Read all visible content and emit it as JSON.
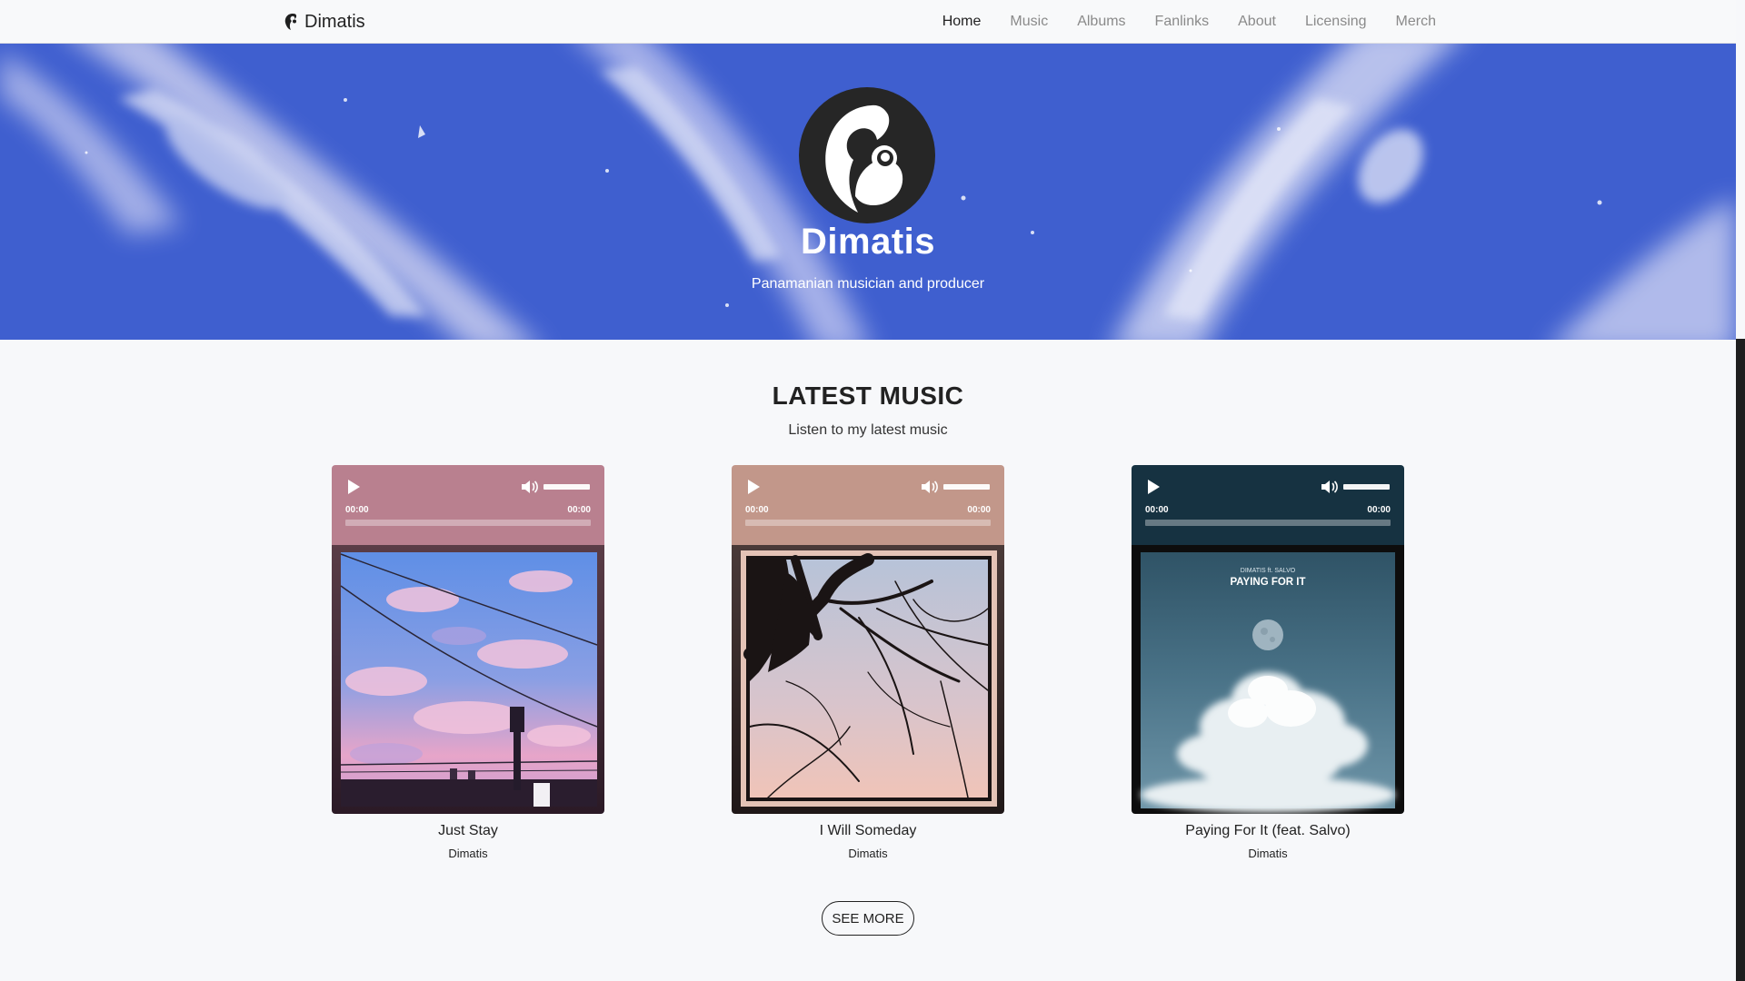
{
  "navbar": {
    "brand": "Dimatis",
    "links": [
      "Home",
      "Music",
      "Albums",
      "Fanlinks",
      "About",
      "Licensing",
      "Merch"
    ],
    "active": "Home"
  },
  "hero": {
    "title": "Dimatis",
    "subtitle": "Panamanian musician and producer"
  },
  "latest": {
    "title": "LATEST MUSIC",
    "subtitle": "Listen to my latest music",
    "see_more": "SEE MORE"
  },
  "tracks": [
    {
      "title": "Just Stay",
      "artist": "Dimatis",
      "current_time": "00:00",
      "duration": "00:00",
      "player_color": "#b9808f"
    },
    {
      "title": "I Will Someday",
      "artist": "Dimatis",
      "current_time": "00:00",
      "duration": "00:00",
      "player_color": "#c2978a"
    },
    {
      "title": "Paying For It (feat. Salvo)",
      "artist": "Dimatis",
      "current_time": "00:00",
      "duration": "00:00",
      "player_color": "#163241",
      "cover_text_top": "DIMATIS ft. SALVO",
      "cover_text_main": "PAYING FOR IT"
    }
  ],
  "colors": {
    "hero_blue": "#3f5fcf",
    "background": "#f7f8fa"
  }
}
